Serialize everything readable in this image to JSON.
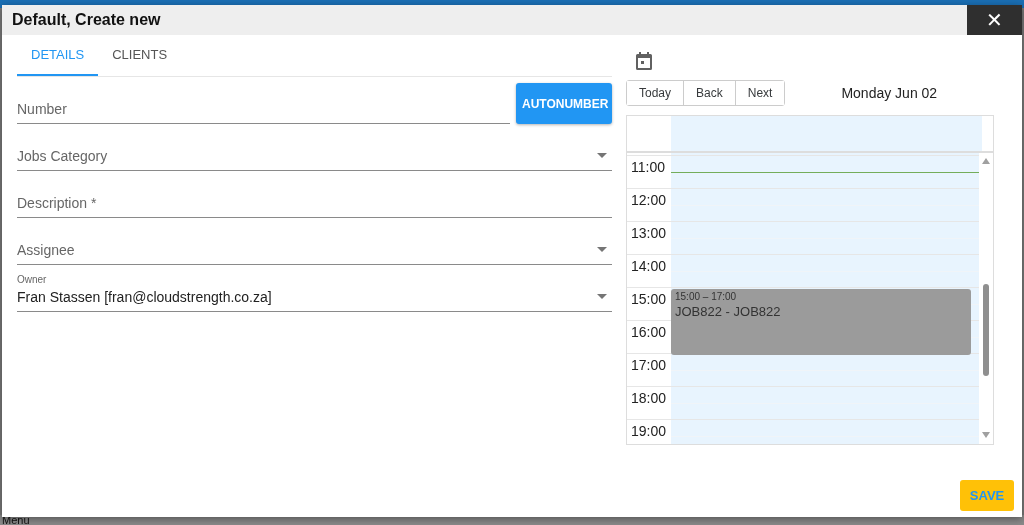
{
  "background": {
    "menu_label": "Menu"
  },
  "dialog": {
    "title": "Default, Create new",
    "close": "✕"
  },
  "tabs": [
    {
      "label": "DETAILS",
      "selected": true
    },
    {
      "label": "CLIENTS",
      "selected": false
    }
  ],
  "fields": [
    {
      "kind": "text",
      "placeholder": "Number",
      "button": "AUTONUMBER"
    },
    {
      "kind": "select",
      "placeholder": "Jobs Category"
    },
    {
      "kind": "text",
      "placeholder": "Description *"
    },
    {
      "kind": "select",
      "placeholder": "Assignee"
    },
    {
      "kind": "select",
      "label": "Owner",
      "value": "Fran Stassen [fran@cloudstrength.co.za]"
    }
  ],
  "calendar": {
    "nav": [
      "Today",
      "Back",
      "Next"
    ],
    "date": "Monday Jun 02",
    "hours": [
      {
        "label": "11:00",
        "current_time": true
      },
      {
        "label": "12:00",
        "current_time": false
      },
      {
        "label": "13:00",
        "current_time": false
      },
      {
        "label": "14:00",
        "current_time": false
      },
      {
        "label": "15:00",
        "current_time": false,
        "event": {
          "time": "15:00 – 17:00",
          "title": "JOB822 - JOB822"
        }
      },
      {
        "label": "16:00",
        "current_time": false
      },
      {
        "label": "17:00",
        "current_time": false
      },
      {
        "label": "18:00",
        "current_time": false
      },
      {
        "label": "19:00",
        "current_time": false
      }
    ]
  },
  "save": "SAVE"
}
